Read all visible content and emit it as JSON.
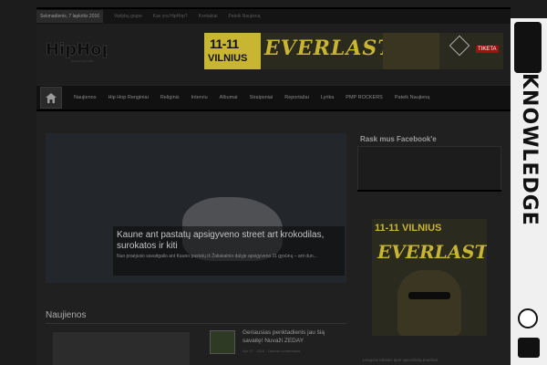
{
  "topbar": {
    "date": "Sekmadienis, 7 lapkritis 2016",
    "links": [
      "Vadybų grupė",
      "Kas yra HipHop?",
      "Kontaktai",
      "Pateik Naujieną"
    ]
  },
  "logo": {
    "text": "HipHop",
    "sub": "GIMUSI GATVĖJE"
  },
  "banner": {
    "date": "11-11",
    "city": "VILNIUS",
    "brand": "EVERLAST",
    "ticket": "TIKETA"
  },
  "nav": {
    "home_icon": "home-icon",
    "items": [
      "Naujienos",
      "Hip Hop Renginiai",
      "Religinis",
      "Interviu",
      "Albumai",
      "Straipsniai",
      "Reportažai",
      "Lyrika",
      "PMP ROCKERS",
      "Pateik Naujieną"
    ]
  },
  "hero": {
    "title": "Kaune ant pastatų apsigyveno street art krokodilas, surokatos ir kiti",
    "excerpt": "Nuo praėjusio savaitgalio ant Kauno pastatų iš Žaliakalnio dalyje apsigyveno 11 gyvūnų – ant dun..."
  },
  "news": {
    "section_title": "Naujienos",
    "item_title": "Geriausias penktadienis jau šią savaitę! Nuvaži ZEDAY",
    "item_meta": "Apr 07 · 2016 · Laisvas komentaras"
  },
  "sidebar": {
    "fb_title": "Rask mus Facebook'e",
    "ad_date": "11-11 VILNIUS",
    "ad_brand": "EVERLAST",
    "link": "Lengvas tekstas apie specialistą Everlast"
  },
  "rightstrip": {
    "word": "KNOWLEDGE"
  }
}
